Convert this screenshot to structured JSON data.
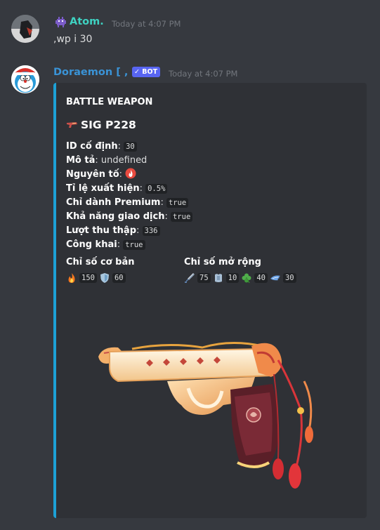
{
  "message1": {
    "username": "Atom.",
    "timestamp": "Today at 4:07 PM",
    "content": ",wp i 30",
    "username_color": "#3fd2c2"
  },
  "message2": {
    "username": "Doraemon [ , ]",
    "bot_badge": "BOT",
    "timestamp": "Today at 4:07 PM",
    "username_color": "#3a93d6"
  },
  "embed": {
    "accent_color": "#1da1d6",
    "title": "BATTLE WEAPON",
    "weapon_name": "SIG P228",
    "fields": [
      {
        "label": "ID cố định",
        "value": "30",
        "code": true
      },
      {
        "label": "Mô tả",
        "value": "undefined",
        "code": false
      },
      {
        "label": "Nguyên tố",
        "value": "fire-element-icon",
        "code": false,
        "icon": true
      },
      {
        "label": "Tỉ lệ xuất hiện",
        "value": "0.5%",
        "code": true
      },
      {
        "label": "Chỉ dành Premium",
        "value": "true",
        "code": true
      },
      {
        "label": "Khả năng giao dịch",
        "value": "true",
        "code": true
      },
      {
        "label": "Lượt thu thập",
        "value": "336",
        "code": true
      },
      {
        "label": "Công khai",
        "value": "true",
        "code": true
      }
    ],
    "base_stats": {
      "heading": "Chỉ số cơ bản",
      "items": [
        {
          "icon": "fire-icon",
          "value": "150"
        },
        {
          "icon": "shield-icon",
          "value": "60"
        }
      ]
    },
    "ext_stats": {
      "heading": "Chỉ số mở rộng",
      "items": [
        {
          "icon": "sword-icon",
          "value": "75"
        },
        {
          "icon": "armor-icon",
          "value": "10"
        },
        {
          "icon": "clover-icon",
          "value": "40"
        },
        {
          "icon": "wing-icon",
          "value": "30"
        }
      ]
    },
    "image": "weapon-image"
  }
}
